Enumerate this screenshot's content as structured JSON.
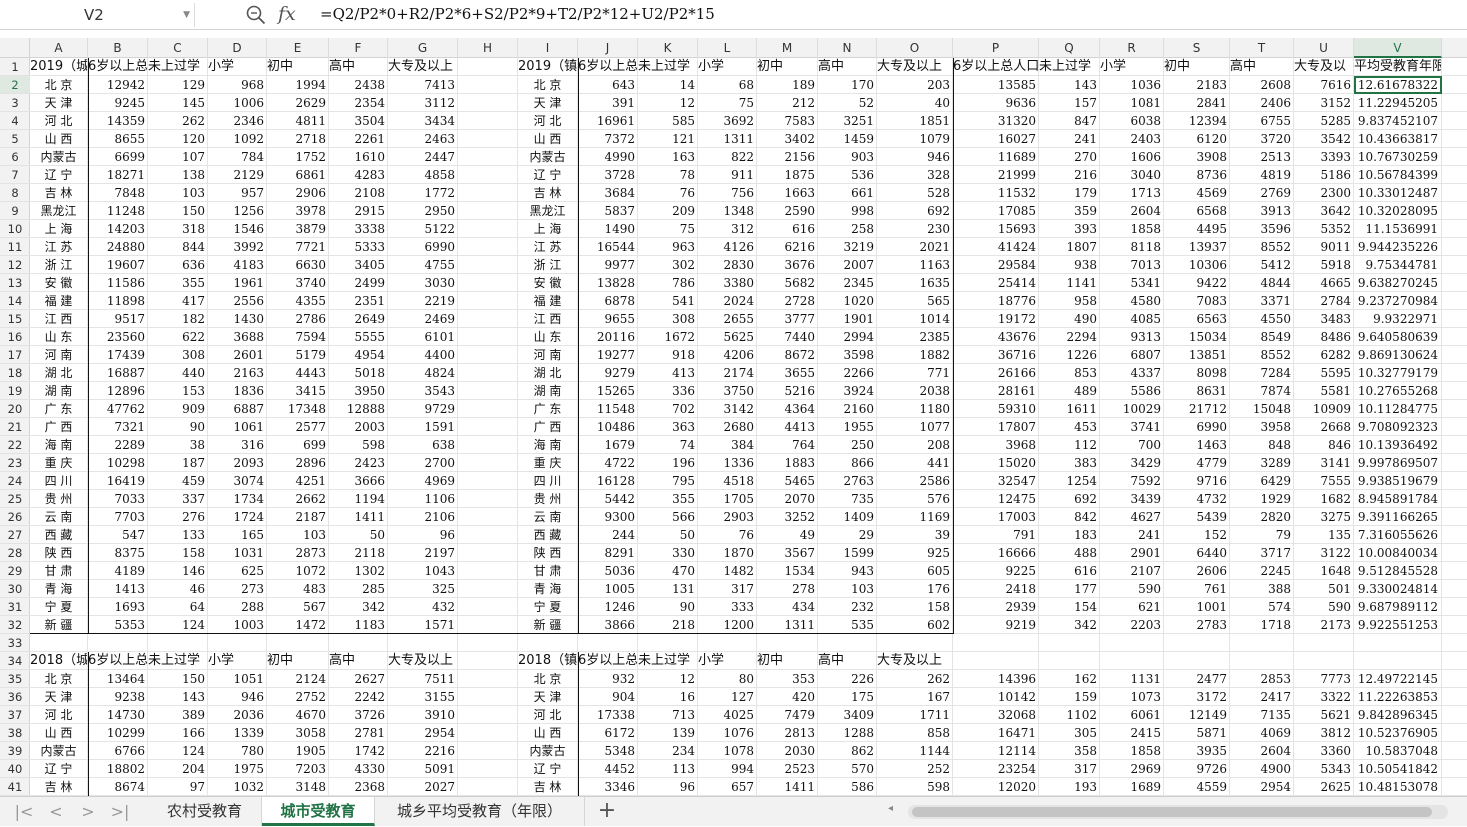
{
  "formula_bar": {
    "name_box": "V2",
    "formula": "=Q2/P2*0+R2/P2*6+S2/P2*9+T2/P2*12+U2/P2*15"
  },
  "columns": [
    "A",
    "B",
    "C",
    "D",
    "E",
    "F",
    "G",
    "H",
    "I",
    "J",
    "K",
    "L",
    "M",
    "N",
    "O",
    "P",
    "Q",
    "R",
    "S",
    "T",
    "U",
    "V"
  ],
  "selected_column": "V",
  "selected_row": 2,
  "rows": [
    {
      "n": 1,
      "c": [
        "2019（城",
        "6岁以上总",
        "未上过学",
        "小学",
        "初中",
        "高中",
        "大专及以上",
        "",
        "2019（镇",
        "6岁以上总",
        "未上过学",
        "小学",
        "初中",
        "高中",
        "大专及以上",
        "6岁以上总人口",
        "未上过学",
        "小学",
        "初中",
        "高中",
        "大专及以",
        "平均受教育年限"
      ]
    },
    {
      "n": 2,
      "c": [
        "北 京",
        "12942",
        "129",
        "968",
        "1994",
        "2438",
        "7413",
        "",
        "北 京",
        "643",
        "14",
        "68",
        "189",
        "170",
        "203",
        "13585",
        "143",
        "1036",
        "2183",
        "2608",
        "7616",
        "12.61678322"
      ]
    },
    {
      "n": 3,
      "c": [
        "天 津",
        "9245",
        "145",
        "1006",
        "2629",
        "2354",
        "3112",
        "",
        "天 津",
        "391",
        "12",
        "75",
        "212",
        "52",
        "40",
        "9636",
        "157",
        "1081",
        "2841",
        "2406",
        "3152",
        "11.22945205"
      ]
    },
    {
      "n": 4,
      "c": [
        "河 北",
        "14359",
        "262",
        "2346",
        "4811",
        "3504",
        "3434",
        "",
        "河 北",
        "16961",
        "585",
        "3692",
        "7583",
        "3251",
        "1851",
        "31320",
        "847",
        "6038",
        "12394",
        "6755",
        "5285",
        "9.837452107"
      ]
    },
    {
      "n": 5,
      "c": [
        "山 西",
        "8655",
        "120",
        "1092",
        "2718",
        "2261",
        "2463",
        "",
        "山 西",
        "7372",
        "121",
        "1311",
        "3402",
        "1459",
        "1079",
        "16027",
        "241",
        "2403",
        "6120",
        "3720",
        "3542",
        "10.43663817"
      ]
    },
    {
      "n": 6,
      "c": [
        "内蒙古",
        "6699",
        "107",
        "784",
        "1752",
        "1610",
        "2447",
        "",
        "内蒙古",
        "4990",
        "163",
        "822",
        "2156",
        "903",
        "946",
        "11689",
        "270",
        "1606",
        "3908",
        "2513",
        "3393",
        "10.76730259"
      ]
    },
    {
      "n": 7,
      "c": [
        "辽 宁",
        "18271",
        "138",
        "2129",
        "6861",
        "4283",
        "4858",
        "",
        "辽 宁",
        "3728",
        "78",
        "911",
        "1875",
        "536",
        "328",
        "21999",
        "216",
        "3040",
        "8736",
        "4819",
        "5186",
        "10.56784399"
      ]
    },
    {
      "n": 8,
      "c": [
        "吉 林",
        "7848",
        "103",
        "957",
        "2906",
        "2108",
        "1772",
        "",
        "吉 林",
        "3684",
        "76",
        "756",
        "1663",
        "661",
        "528",
        "11532",
        "179",
        "1713",
        "4569",
        "2769",
        "2300",
        "10.33012487"
      ]
    },
    {
      "n": 9,
      "c": [
        "黑龙江",
        "11248",
        "150",
        "1256",
        "3978",
        "2915",
        "2950",
        "",
        "黑龙江",
        "5837",
        "209",
        "1348",
        "2590",
        "998",
        "692",
        "17085",
        "359",
        "2604",
        "6568",
        "3913",
        "3642",
        "10.32028095"
      ]
    },
    {
      "n": 10,
      "c": [
        "上 海",
        "14203",
        "318",
        "1546",
        "3879",
        "3338",
        "5122",
        "",
        "上 海",
        "1490",
        "75",
        "312",
        "616",
        "258",
        "230",
        "15693",
        "393",
        "1858",
        "4495",
        "3596",
        "5352",
        "11.1536991"
      ]
    },
    {
      "n": 11,
      "c": [
        "江 苏",
        "24880",
        "844",
        "3992",
        "7721",
        "5333",
        "6990",
        "",
        "江 苏",
        "16544",
        "963",
        "4126",
        "6216",
        "3219",
        "2021",
        "41424",
        "1807",
        "8118",
        "13937",
        "8552",
        "9011",
        "9.944235226"
      ]
    },
    {
      "n": 12,
      "c": [
        "浙 江",
        "19607",
        "636",
        "4183",
        "6630",
        "3405",
        "4755",
        "",
        "浙 江",
        "9977",
        "302",
        "2830",
        "3676",
        "2007",
        "1163",
        "29584",
        "938",
        "7013",
        "10306",
        "5412",
        "5918",
        "9.75344781"
      ]
    },
    {
      "n": 13,
      "c": [
        "安 徽",
        "11586",
        "355",
        "1961",
        "3740",
        "2499",
        "3030",
        "",
        "安 徽",
        "13828",
        "786",
        "3380",
        "5682",
        "2345",
        "1635",
        "25414",
        "1141",
        "5341",
        "9422",
        "4844",
        "4665",
        "9.638270245"
      ]
    },
    {
      "n": 14,
      "c": [
        "福 建",
        "11898",
        "417",
        "2556",
        "4355",
        "2351",
        "2219",
        "",
        "福 建",
        "6878",
        "541",
        "2024",
        "2728",
        "1020",
        "565",
        "18776",
        "958",
        "4580",
        "7083",
        "3371",
        "2784",
        "9.237270984"
      ]
    },
    {
      "n": 15,
      "c": [
        "江 西",
        "9517",
        "182",
        "1430",
        "2786",
        "2649",
        "2469",
        "",
        "江 西",
        "9655",
        "308",
        "2655",
        "3777",
        "1901",
        "1014",
        "19172",
        "490",
        "4085",
        "6563",
        "4550",
        "3483",
        "9.9322971"
      ]
    },
    {
      "n": 16,
      "c": [
        "山 东",
        "23560",
        "622",
        "3688",
        "7594",
        "5555",
        "6101",
        "",
        "山 东",
        "20116",
        "1672",
        "5625",
        "7440",
        "2994",
        "2385",
        "43676",
        "2294",
        "9313",
        "15034",
        "8549",
        "8486",
        "9.640580639"
      ]
    },
    {
      "n": 17,
      "c": [
        "河 南",
        "17439",
        "308",
        "2601",
        "5179",
        "4954",
        "4400",
        "",
        "河 南",
        "19277",
        "918",
        "4206",
        "8672",
        "3598",
        "1882",
        "36716",
        "1226",
        "6807",
        "13851",
        "8552",
        "6282",
        "9.869130624"
      ]
    },
    {
      "n": 18,
      "c": [
        "湖 北",
        "16887",
        "440",
        "2163",
        "4443",
        "5018",
        "4824",
        "",
        "湖 北",
        "9279",
        "413",
        "2174",
        "3655",
        "2266",
        "771",
        "26166",
        "853",
        "4337",
        "8098",
        "7284",
        "5595",
        "10.32779179"
      ]
    },
    {
      "n": 19,
      "c": [
        "湖 南",
        "12896",
        "153",
        "1836",
        "3415",
        "3950",
        "3543",
        "",
        "湖 南",
        "15265",
        "336",
        "3750",
        "5216",
        "3924",
        "2038",
        "28161",
        "489",
        "5586",
        "8631",
        "7874",
        "5581",
        "10.27655268"
      ]
    },
    {
      "n": 20,
      "c": [
        "广 东",
        "47762",
        "909",
        "6887",
        "17348",
        "12888",
        "9729",
        "",
        "广 东",
        "11548",
        "702",
        "3142",
        "4364",
        "2160",
        "1180",
        "59310",
        "1611",
        "10029",
        "21712",
        "15048",
        "10909",
        "10.11284775"
      ]
    },
    {
      "n": 21,
      "c": [
        "广 西",
        "7321",
        "90",
        "1061",
        "2577",
        "2003",
        "1591",
        "",
        "广 西",
        "10486",
        "363",
        "2680",
        "4413",
        "1955",
        "1077",
        "17807",
        "453",
        "3741",
        "6990",
        "3958",
        "2668",
        "9.708092323"
      ]
    },
    {
      "n": 22,
      "c": [
        "海 南",
        "2289",
        "38",
        "316",
        "699",
        "598",
        "638",
        "",
        "海 南",
        "1679",
        "74",
        "384",
        "764",
        "250",
        "208",
        "3968",
        "112",
        "700",
        "1463",
        "848",
        "846",
        "10.13936492"
      ]
    },
    {
      "n": 23,
      "c": [
        "重 庆",
        "10298",
        "187",
        "2093",
        "2896",
        "2423",
        "2700",
        "",
        "重 庆",
        "4722",
        "196",
        "1336",
        "1883",
        "866",
        "441",
        "15020",
        "383",
        "3429",
        "4779",
        "3289",
        "3141",
        "9.997869507"
      ]
    },
    {
      "n": 24,
      "c": [
        "四 川",
        "16419",
        "459",
        "3074",
        "4251",
        "3666",
        "4969",
        "",
        "四 川",
        "16128",
        "795",
        "4518",
        "5465",
        "2763",
        "2586",
        "32547",
        "1254",
        "7592",
        "9716",
        "6429",
        "7555",
        "9.938519679"
      ]
    },
    {
      "n": 25,
      "c": [
        "贵 州",
        "7033",
        "337",
        "1734",
        "2662",
        "1194",
        "1106",
        "",
        "贵 州",
        "5442",
        "355",
        "1705",
        "2070",
        "735",
        "576",
        "12475",
        "692",
        "3439",
        "4732",
        "1929",
        "1682",
        "8.945891784"
      ]
    },
    {
      "n": 26,
      "c": [
        "云 南",
        "7703",
        "276",
        "1724",
        "2187",
        "1411",
        "2106",
        "",
        "云 南",
        "9300",
        "566",
        "2903",
        "3252",
        "1409",
        "1169",
        "17003",
        "842",
        "4627",
        "5439",
        "2820",
        "3275",
        "9.391166265"
      ]
    },
    {
      "n": 27,
      "c": [
        "西 藏",
        "547",
        "133",
        "165",
        "103",
        "50",
        "96",
        "",
        "西 藏",
        "244",
        "50",
        "76",
        "49",
        "29",
        "39",
        "791",
        "183",
        "241",
        "152",
        "79",
        "135",
        "7.316055626"
      ]
    },
    {
      "n": 28,
      "c": [
        "陕 西",
        "8375",
        "158",
        "1031",
        "2873",
        "2118",
        "2197",
        "",
        "陕 西",
        "8291",
        "330",
        "1870",
        "3567",
        "1599",
        "925",
        "16666",
        "488",
        "2901",
        "6440",
        "3717",
        "3122",
        "10.00840034"
      ]
    },
    {
      "n": 29,
      "c": [
        "甘 肃",
        "4189",
        "146",
        "625",
        "1072",
        "1302",
        "1043",
        "",
        "甘 肃",
        "5036",
        "470",
        "1482",
        "1534",
        "943",
        "605",
        "9225",
        "616",
        "2107",
        "2606",
        "2245",
        "1648",
        "9.512845528"
      ]
    },
    {
      "n": 30,
      "c": [
        "青 海",
        "1413",
        "46",
        "273",
        "483",
        "285",
        "325",
        "",
        "青 海",
        "1005",
        "131",
        "317",
        "278",
        "103",
        "176",
        "2418",
        "177",
        "590",
        "761",
        "388",
        "501",
        "9.330024814"
      ]
    },
    {
      "n": 31,
      "c": [
        "宁 夏",
        "1693",
        "64",
        "288",
        "567",
        "342",
        "432",
        "",
        "宁 夏",
        "1246",
        "90",
        "333",
        "434",
        "232",
        "158",
        "2939",
        "154",
        "621",
        "1001",
        "574",
        "590",
        "9.687989112"
      ]
    },
    {
      "n": 32,
      "c": [
        "新 疆",
        "5353",
        "124",
        "1003",
        "1472",
        "1183",
        "1571",
        "",
        "新 疆",
        "3866",
        "218",
        "1200",
        "1311",
        "535",
        "602",
        "9219",
        "342",
        "2203",
        "2783",
        "1718",
        "2173",
        "9.922551253"
      ]
    },
    {
      "n": 33,
      "c": [
        "",
        "",
        "",
        "",
        "",
        "",
        "",
        "",
        "",
        "",
        "",
        "",
        "",
        "",
        "",
        "",
        "",
        "",
        "",
        "",
        "",
        ""
      ]
    },
    {
      "n": 34,
      "c": [
        "2018（城",
        "6岁以上总",
        "未上过学",
        "小学",
        "初中",
        "高中",
        "大专及以上",
        "",
        "2018（镇",
        "6岁以上总",
        "未上过学",
        "小学",
        "初中",
        "高中",
        "大专及以上",
        "",
        "",
        "",
        "",
        "",
        "",
        ""
      ]
    },
    {
      "n": 35,
      "c": [
        "北 京",
        "13464",
        "150",
        "1051",
        "2124",
        "2627",
        "7511",
        "",
        "北 京",
        "932",
        "12",
        "80",
        "353",
        "226",
        "262",
        "14396",
        "162",
        "1131",
        "2477",
        "2853",
        "7773",
        "12.49722145"
      ]
    },
    {
      "n": 36,
      "c": [
        "天 津",
        "9238",
        "143",
        "946",
        "2752",
        "2242",
        "3155",
        "",
        "天 津",
        "904",
        "16",
        "127",
        "420",
        "175",
        "167",
        "10142",
        "159",
        "1073",
        "3172",
        "2417",
        "3322",
        "11.22263853"
      ]
    },
    {
      "n": 37,
      "c": [
        "河 北",
        "14730",
        "389",
        "2036",
        "4670",
        "3726",
        "3910",
        "",
        "河 北",
        "17338",
        "713",
        "4025",
        "7479",
        "3409",
        "1711",
        "32068",
        "1102",
        "6061",
        "12149",
        "7135",
        "5621",
        "9.842896345"
      ]
    },
    {
      "n": 38,
      "c": [
        "山 西",
        "10299",
        "166",
        "1339",
        "3058",
        "2781",
        "2954",
        "",
        "山 西",
        "6172",
        "139",
        "1076",
        "2813",
        "1288",
        "858",
        "16471",
        "305",
        "2415",
        "5871",
        "4069",
        "3812",
        "10.52376905"
      ]
    },
    {
      "n": 39,
      "c": [
        "内蒙古",
        "6766",
        "124",
        "780",
        "1905",
        "1742",
        "2216",
        "",
        "内蒙古",
        "5348",
        "234",
        "1078",
        "2030",
        "862",
        "1144",
        "12114",
        "358",
        "1858",
        "3935",
        "2604",
        "3360",
        "10.5837048"
      ]
    },
    {
      "n": 40,
      "c": [
        "辽 宁",
        "18802",
        "204",
        "1975",
        "7203",
        "4330",
        "5091",
        "",
        "辽 宁",
        "4452",
        "113",
        "994",
        "2523",
        "570",
        "252",
        "23254",
        "317",
        "2969",
        "9726",
        "4900",
        "5343",
        "10.50541842"
      ]
    },
    {
      "n": 41,
      "c": [
        "吉 林",
        "8674",
        "97",
        "1032",
        "3148",
        "2368",
        "2027",
        "",
        "吉 林",
        "3346",
        "96",
        "657",
        "1411",
        "586",
        "598",
        "12020",
        "193",
        "1689",
        "4559",
        "2954",
        "2625",
        "10.48153078"
      ]
    }
  ],
  "tabs": [
    {
      "label": "农村受教育",
      "active": false
    },
    {
      "label": "城市受教育",
      "active": true
    },
    {
      "label": "城乡平均受教育（年限）",
      "active": false
    }
  ],
  "nav_buttons": [
    "|<",
    "<",
    ">",
    ">|"
  ],
  "add_tab_label": "+",
  "accent_color": "#217346"
}
